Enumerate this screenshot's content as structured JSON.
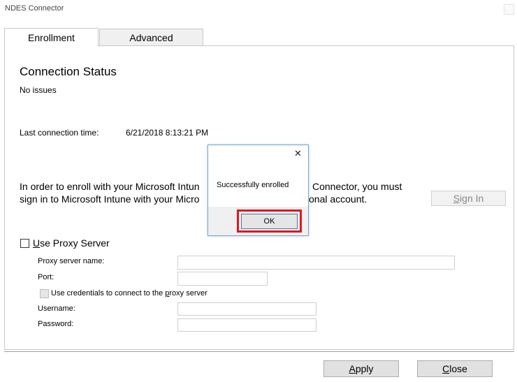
{
  "window": {
    "title": "NDES Connector"
  },
  "tabs": [
    {
      "label": "Enrollment",
      "active": true
    },
    {
      "label": "Advanced",
      "active": false
    }
  ],
  "connection": {
    "heading": "Connection Status",
    "status": "No issues",
    "last_time_label": "Last connection time:",
    "last_time_value": "6/21/2018 8:13:21 PM"
  },
  "enroll": {
    "line1_a": "In order to enroll with your Microsoft Intun",
    "line1_b": "Connector, you must",
    "line2_a": "sign in to Microsoft Intune with your Micro",
    "line2_b": "onal account.",
    "sign_in": {
      "accel": "S",
      "rest": "ign In"
    }
  },
  "proxy": {
    "use_proxy": {
      "accel": "U",
      "rest": "se Proxy Server"
    },
    "server_name_label": "Proxy server name:",
    "port_label": "Port:",
    "use_credentials": {
      "before": "Use credentials to connect to the ",
      "accel": "p",
      "after": "roxy server"
    },
    "username_label": "Username:",
    "password_label": "Password:"
  },
  "footer": {
    "apply": {
      "accel": "A",
      "rest": "pply"
    },
    "close": {
      "accel": "C",
      "rest": "lose"
    }
  },
  "dialog": {
    "message": "Successfully enrolled",
    "ok_label": "OK",
    "close_glyph": "✕"
  }
}
